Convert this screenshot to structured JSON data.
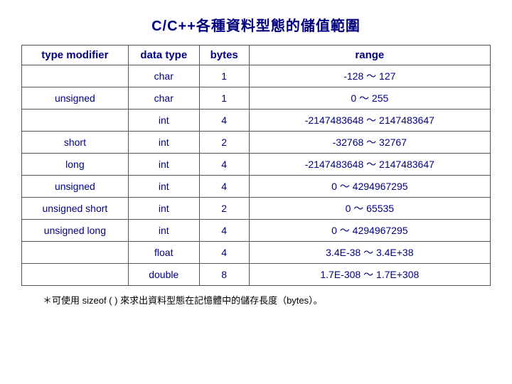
{
  "title": "C/C++各種資料型態的儲值範圍",
  "table": {
    "headers": [
      "type modifier",
      "data type",
      "bytes",
      "range"
    ],
    "rows": [
      {
        "type": "",
        "data": "char",
        "bytes": "1",
        "range": "-128 ～ 127"
      },
      {
        "type": "unsigned",
        "data": "char",
        "bytes": "1",
        "range": "0 ～ 255"
      },
      {
        "type": "",
        "data": "int",
        "bytes": "4",
        "range": "-2147483648 ～ 2147483647"
      },
      {
        "type": "short",
        "data": "int",
        "bytes": "2",
        "range": "-32768 ～ 32767"
      },
      {
        "type": "long",
        "data": "int",
        "bytes": "4",
        "range": "-2147483648 ～ 2147483647"
      },
      {
        "type": "unsigned",
        "data": "int",
        "bytes": "4",
        "range": "0 ～ 4294967295"
      },
      {
        "type": "unsigned short",
        "data": "int",
        "bytes": "2",
        "range": "0 ～ 65535"
      },
      {
        "type": "unsigned long",
        "data": "int",
        "bytes": "4",
        "range": "0 ～ 4294967295"
      },
      {
        "type": "",
        "data": "float",
        "bytes": "4",
        "range": "3.4E-38 ～ 3.4E+38"
      },
      {
        "type": "",
        "data": "double",
        "bytes": "8",
        "range": "1.7E-308 ～ 1.7E+308"
      }
    ]
  },
  "note": "＊可使用 sizeof ( ) 來求出資料型態在記憶體中的儲存長度（bytes）。"
}
